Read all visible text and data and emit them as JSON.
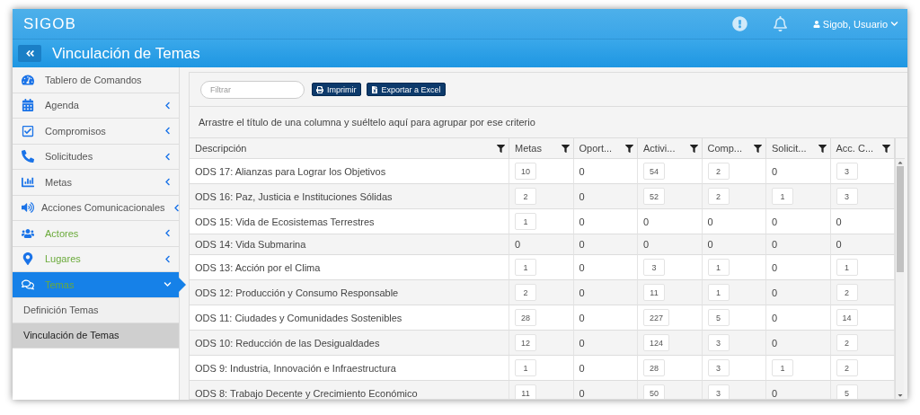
{
  "header": {
    "brand": "SIGOB",
    "user": "Sigob, Usuario"
  },
  "subheader": {
    "title": "Vinculación de Temas"
  },
  "sidebar": {
    "items": [
      {
        "label": "Tablero de Comandos",
        "selected": false,
        "color": "#555555"
      },
      {
        "label": "Agenda",
        "expanded": false,
        "selected": false,
        "color": "#555555"
      },
      {
        "label": "Compromisos",
        "expanded": false,
        "selected": false,
        "color": "#555555"
      },
      {
        "label": "Solicitudes",
        "expanded": false,
        "selected": false,
        "color": "#555555"
      },
      {
        "label": "Metas",
        "expanded": false,
        "selected": false,
        "color": "#555555"
      },
      {
        "label": "Acciones Comunicacionales",
        "expanded": false,
        "selected": false,
        "color": "#555555"
      },
      {
        "label": "Actores",
        "expanded": false,
        "selected": false,
        "color": "#6aaa3a"
      },
      {
        "label": "Lugares",
        "expanded": false,
        "selected": false,
        "color": "#6aaa3a"
      },
      {
        "label": "Temas",
        "expanded": true,
        "selected": true,
        "color": "#6aaa3a",
        "children": [
          {
            "label": "Definición Temas",
            "selected": false
          },
          {
            "label": "Vinculación de Temas",
            "selected": true
          }
        ]
      }
    ]
  },
  "toolbar": {
    "filter": {
      "placeholder": "Filtrar"
    },
    "buttons": [
      "Imprimir",
      "Exportar a Excel"
    ]
  },
  "group_hint": "Arrastre el título de una columna y suéltelo aquí para agrupar por ese criterio",
  "table": {
    "columns": [
      "Descripción",
      "Metas",
      "Oport...",
      "Activi...",
      "Comp...",
      "Solicit...",
      "Acc. C..."
    ],
    "rows": [
      {
        "cells": [
          {
            "text": "ODS 17: Alianzas para Lograr los Objetivos",
            "boxed": false
          },
          {
            "text": "10",
            "boxed": true
          },
          {
            "text": "0",
            "boxed": false
          },
          {
            "text": "54",
            "boxed": true
          },
          {
            "text": "2",
            "boxed": true
          },
          {
            "text": "0",
            "boxed": false
          },
          {
            "text": "3",
            "boxed": true
          }
        ]
      },
      {
        "cells": [
          {
            "text": "ODS 16: Paz, Justicia e Instituciones Sólidas",
            "boxed": false
          },
          {
            "text": "2",
            "boxed": true
          },
          {
            "text": "0",
            "boxed": false
          },
          {
            "text": "52",
            "boxed": true
          },
          {
            "text": "2",
            "boxed": true
          },
          {
            "text": "1",
            "boxed": true
          },
          {
            "text": "3",
            "boxed": true
          }
        ]
      },
      {
        "cells": [
          {
            "text": "ODS 15: Vida de Ecosistemas Terrestres",
            "boxed": false
          },
          {
            "text": "1",
            "boxed": true
          },
          {
            "text": "0",
            "boxed": false
          },
          {
            "text": "0",
            "boxed": false
          },
          {
            "text": "0",
            "boxed": false
          },
          {
            "text": "0",
            "boxed": false
          },
          {
            "text": "0",
            "boxed": false
          }
        ]
      },
      {
        "cells": [
          {
            "text": "ODS 14: Vida Submarina",
            "boxed": false
          },
          {
            "text": "0",
            "boxed": false
          },
          {
            "text": "0",
            "boxed": false
          },
          {
            "text": "0",
            "boxed": false
          },
          {
            "text": "0",
            "boxed": false
          },
          {
            "text": "0",
            "boxed": false
          },
          {
            "text": "0",
            "boxed": false
          }
        ]
      },
      {
        "cells": [
          {
            "text": "ODS 13: Acción por el Clima",
            "boxed": false
          },
          {
            "text": "1",
            "boxed": true
          },
          {
            "text": "0",
            "boxed": false
          },
          {
            "text": "3",
            "boxed": true
          },
          {
            "text": "1",
            "boxed": true
          },
          {
            "text": "0",
            "boxed": false
          },
          {
            "text": "1",
            "boxed": true
          }
        ]
      },
      {
        "cells": [
          {
            "text": "ODS 12: Producción y Consumo Responsable",
            "boxed": false
          },
          {
            "text": "2",
            "boxed": true
          },
          {
            "text": "0",
            "boxed": false
          },
          {
            "text": "11",
            "boxed": true
          },
          {
            "text": "1",
            "boxed": true
          },
          {
            "text": "0",
            "boxed": false
          },
          {
            "text": "2",
            "boxed": true
          }
        ]
      },
      {
        "cells": [
          {
            "text": "ODS 11: Ciudades y Comunidades Sostenibles",
            "boxed": false
          },
          {
            "text": "28",
            "boxed": true
          },
          {
            "text": "0",
            "boxed": false
          },
          {
            "text": "227",
            "boxed": true
          },
          {
            "text": "5",
            "boxed": true
          },
          {
            "text": "0",
            "boxed": false
          },
          {
            "text": "14",
            "boxed": true
          }
        ]
      },
      {
        "cells": [
          {
            "text": "ODS 10: Reducción de las Desigualdades",
            "boxed": false
          },
          {
            "text": "12",
            "boxed": true
          },
          {
            "text": "0",
            "boxed": false
          },
          {
            "text": "124",
            "boxed": true
          },
          {
            "text": "3",
            "boxed": true
          },
          {
            "text": "0",
            "boxed": false
          },
          {
            "text": "2",
            "boxed": true
          }
        ]
      },
      {
        "cells": [
          {
            "text": "ODS 9: Industria, Innovación e Infraestructura",
            "boxed": false
          },
          {
            "text": "1",
            "boxed": true
          },
          {
            "text": "0",
            "boxed": false
          },
          {
            "text": "28",
            "boxed": true
          },
          {
            "text": "3",
            "boxed": true
          },
          {
            "text": "1",
            "boxed": true
          },
          {
            "text": "2",
            "boxed": true
          }
        ]
      },
      {
        "cells": [
          {
            "text": "ODS 8: Trabajo Decente y Crecimiento Económico",
            "boxed": false
          },
          {
            "text": "11",
            "boxed": true
          },
          {
            "text": "0",
            "boxed": false
          },
          {
            "text": "50",
            "boxed": true
          },
          {
            "text": "3",
            "boxed": true
          },
          {
            "text": "0",
            "boxed": false
          },
          {
            "text": "5",
            "boxed": true
          }
        ]
      }
    ]
  }
}
